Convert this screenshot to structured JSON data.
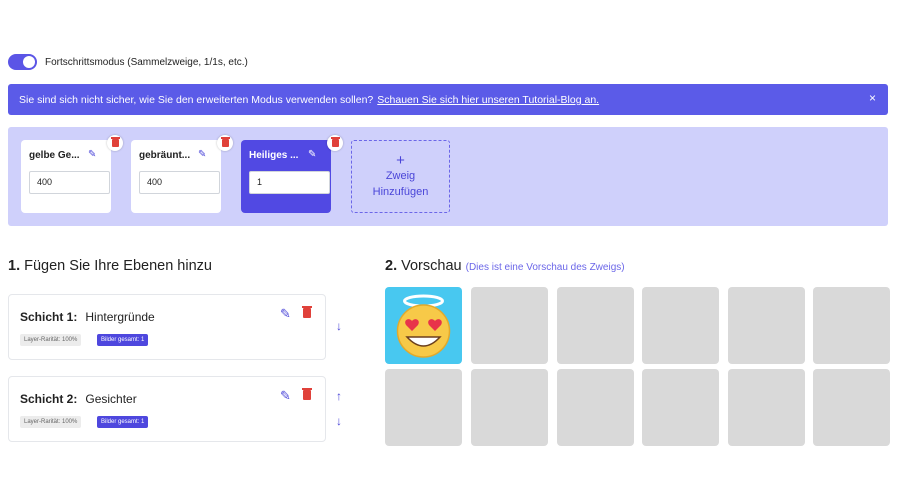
{
  "toggle": {
    "label": "Fortschrittsmodus (Sammelzweige, 1/1s, etc.)",
    "on": true
  },
  "banner": {
    "text": "Sie sind sich nicht sicher, wie Sie den erweiterten Modus verwenden sollen?",
    "link": "Schauen Sie sich hier unseren Tutorial-Blog an.",
    "close": "×"
  },
  "branches": [
    {
      "name": "gelbe Ge...",
      "value": "400",
      "active": false
    },
    {
      "name": "gebräunt...",
      "value": "400",
      "active": false
    },
    {
      "name": "Heiliges ...",
      "value": "1",
      "active": true
    }
  ],
  "add_branch": {
    "plus": "+",
    "line1": "Zweig",
    "line2": "Hinzufügen"
  },
  "layers_section": {
    "number": "1.",
    "title": "Fügen Sie Ihre Ebenen hinzu"
  },
  "preview_section": {
    "number": "2.",
    "title": "Vorschau",
    "note": "(Dies ist eine Vorschau des Zweigs)"
  },
  "layers": [
    {
      "label": "Schicht 1:",
      "name": "Hintergründe",
      "rarity": "Layer-Rarität: 100%",
      "total": "Bilder gesamt: 1"
    },
    {
      "label": "Schicht 2:",
      "name": "Gesichter",
      "rarity": "Layer-Rarität: 100%",
      "total": "Bilder gesamt: 1"
    }
  ],
  "icons": {
    "edit": "pencil-icon",
    "delete": "trash-icon",
    "up": "arrow-up-icon",
    "down": "arrow-down-icon",
    "preview_image": "smiling-face-with-heart-eyes-and-halo"
  },
  "colors": {
    "accent": "#5b55e6",
    "panel": "#cfd0fb",
    "delete": "#e0413a",
    "placeholder": "#d9d9d9"
  },
  "preview_grid": {
    "columns": 6,
    "rows": 2,
    "filled_tiles": 1
  }
}
